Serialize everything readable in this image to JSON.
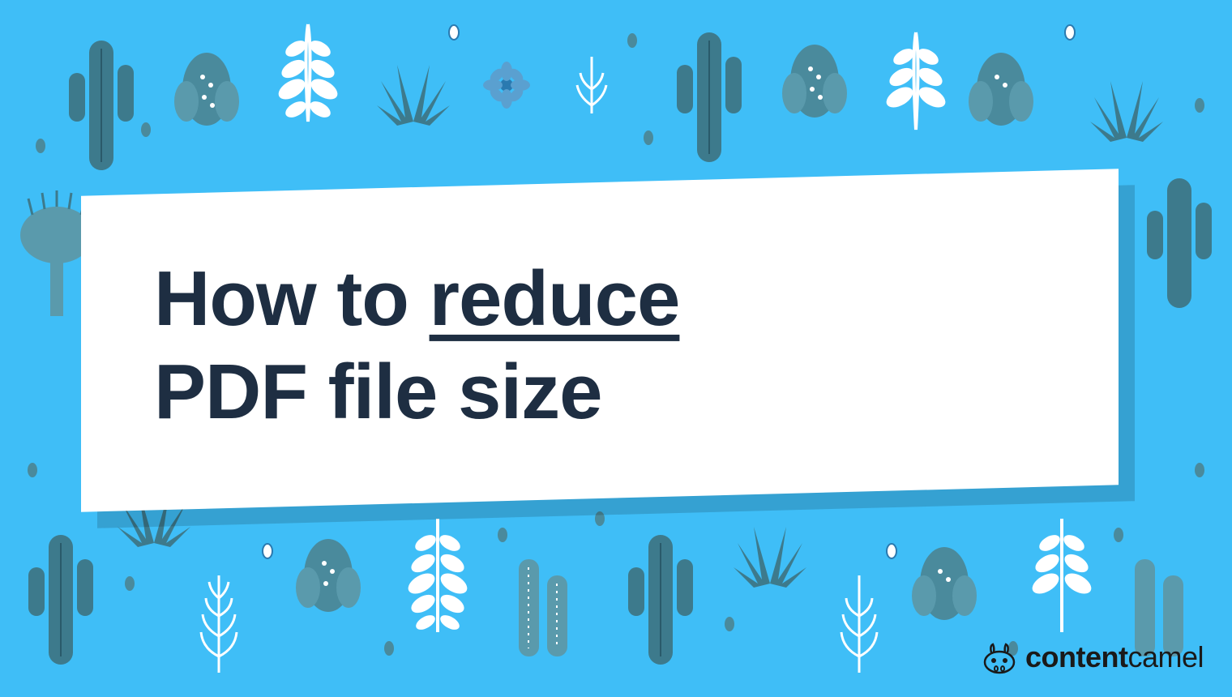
{
  "title": {
    "line1_part1": "How to ",
    "line1_underlined": "reduce",
    "line2": "PDF file size"
  },
  "logo": {
    "brand_bold": "content",
    "brand_light": "camel"
  },
  "colors": {
    "background": "#3FBEF7",
    "title_text": "#1e2e42",
    "cactus_dark": "#3d7a8c",
    "cactus_light": "#6fa8b8",
    "white": "#ffffff"
  }
}
